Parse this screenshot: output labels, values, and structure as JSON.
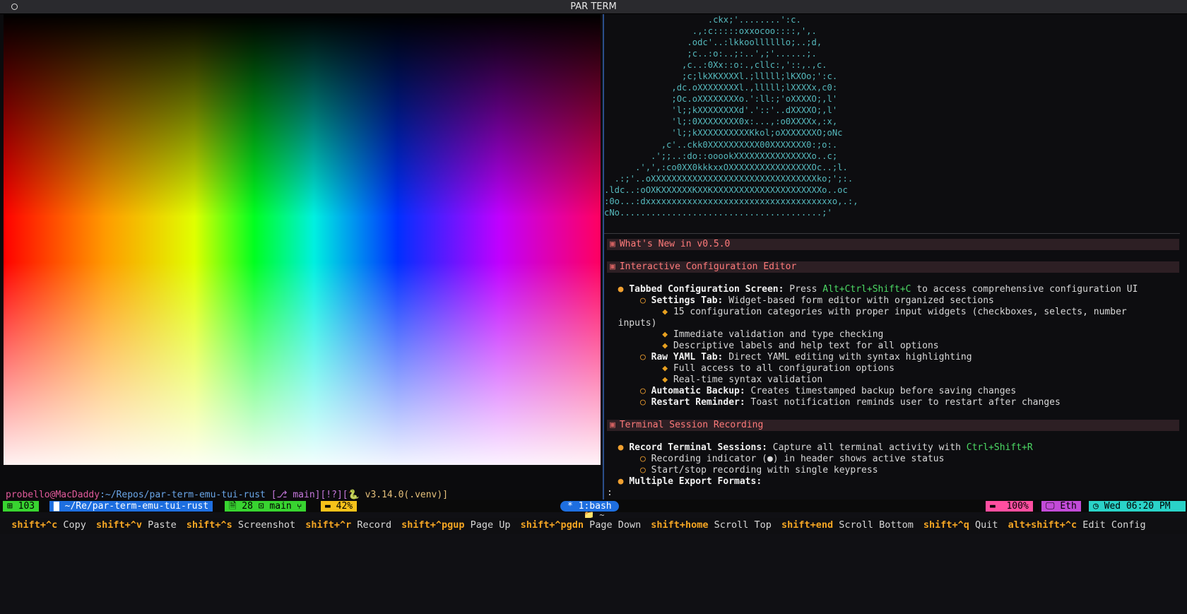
{
  "window": {
    "title": "PAR TERM"
  },
  "left_pane": {
    "prompt": {
      "user_host": "probello@MacDaddy",
      "path": ":~/Repos/par-term-emu-tui-rust",
      "git": " [⎇ main][!?][",
      "python": " v3.14.0(.venv)]"
    },
    "cursor_symbol": "❯"
  },
  "right_pane": {
    "ascii_art": [
      "                    .ckx;'........':c.",
      "                 .,:c:::::oxxocoo::::,',.",
      "                .odc'..:lkkoollllllo;..;d,",
      "                ;c..:o:..;:..',;'......;.",
      "               ,c..:0Xx::o:.,cllc:,'::,.,c.",
      "               ;c;lkXKXXXXl.;lllll;lKXOo;':c.",
      "             ,dc.oXXXXXXXXl.,lllll;lXXXXx,c0:",
      "             ;Oc.oXXXXXXXXo.':ll:;'oXXXXO;,l'",
      "             'l;;kXXXXXXXXd'.'::'..dXXXXO;,l'",
      "             'l;:0XXXXXXXX0x:...,:o0XXXXx,:x,",
      "             'l;;kXXXXXXXXXXKkol;oXXXXXXXO;oNc",
      "           ,c'..ckk0XXXXXXXXXX00XXXXXXX0:;o:.",
      "         .';;..:do::ooookXXXXXXXXXXXXXXXo..c;",
      "      .',',:co0XX0kkkxxOXXXXXXXXXXXXXXXXOc..;l.",
      "  .:;'..oXXXXXXXXXXXXXXXXXXXXXXXXXXXXXXXXko;';:.",
      ".ldc..:oOXKXXXXXXKXXKXXXXXXXXXXXXXXXXXXXXXo..oc",
      ":0o...:dxxxxxxxxxxxxxxxxxxxxxxxxxxxxxxxxxxxxo,.:,",
      "cNo.......................................;'"
    ],
    "markdown": {
      "h_whats_new": "What's New in v0.5.0",
      "h_config_editor": "Interactive Configuration Editor",
      "config_items": {
        "tabbed_label": "Tabbed Configuration Screen:",
        "tabbed_pre": " Press ",
        "tabbed_key": "Alt+Ctrl+Shift+C",
        "tabbed_post": " to access comprehensive configuration UI",
        "settings_label": "Settings Tab:",
        "settings_text": " Widget-based form editor with organized sections",
        "settings_sub1a": "15 configuration categories with proper input widgets (checkboxes, selects, number",
        "settings_sub1b": "inputs)",
        "settings_sub2": "Immediate validation and type checking",
        "settings_sub3": "Descriptive labels and help text for all options",
        "yaml_label": "Raw YAML Tab:",
        "yaml_text": " Direct YAML editing with syntax highlighting",
        "yaml_sub1": "Full access to all configuration options",
        "yaml_sub2": "Real-time syntax validation",
        "backup_label": "Automatic Backup:",
        "backup_text": " Creates timestamped backup before saving changes",
        "restart_label": "Restart Reminder:",
        "restart_text": " Toast notification reminds user to restart after changes"
      },
      "h_recording": "Terminal Session Recording",
      "recording_items": {
        "record_label": "Record Terminal Sessions:",
        "record_pre": " Capture all terminal activity with ",
        "record_key": "Ctrl+Shift+R",
        "indicator": "Recording indicator (●) in header shows active status",
        "startstop": "Start/stop recording with single keypress",
        "export_label": "Multiple Export Formats:"
      },
      "pager_prompt": ":"
    }
  },
  "status_bar": {
    "left": {
      "count": "103",
      "path": "~/Re/par-term-emu-tui-rust",
      "files": "28",
      "branch": "main",
      "battery": "42%"
    },
    "center": {
      "tab": "* 1:bash"
    },
    "right": {
      "zoom": "100%",
      "net": "Eth",
      "datetime": "Wed 06:20 PM"
    },
    "folder": "~"
  },
  "keybinds": [
    {
      "key": "shift+^c",
      "label": "Copy"
    },
    {
      "key": "shift+^v",
      "label": "Paste"
    },
    {
      "key": "shift+^s",
      "label": "Screenshot"
    },
    {
      "key": "shift+^r",
      "label": "Record"
    },
    {
      "key": "shift+^pgup",
      "label": "Page Up"
    },
    {
      "key": "shift+^pgdn",
      "label": "Page Down"
    },
    {
      "key": "shift+home",
      "label": "Scroll Top"
    },
    {
      "key": "shift+end",
      "label": "Scroll Bottom"
    },
    {
      "key": "shift+^q",
      "label": "Quit"
    },
    {
      "key": "alt+shift+^c",
      "label": "Edit Config"
    }
  ],
  "colors": {
    "accent_green": "#38d430",
    "accent_blue": "#1e6fe0",
    "accent_yellow": "#f7c21a",
    "accent_pink": "#ff4fa0",
    "accent_cyan": "#2ad3c8",
    "ascii_art": "#55b9bd"
  }
}
